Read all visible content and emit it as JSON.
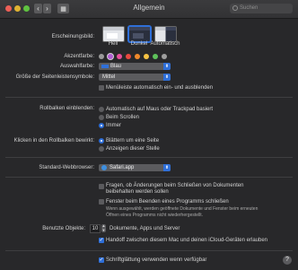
{
  "window": {
    "title": "Allgemein",
    "search_placeholder": "Suchen"
  },
  "appearance": {
    "label": "Erscheinungsbild:",
    "options": [
      {
        "name": "Hell",
        "selected": false
      },
      {
        "name": "Dunkel",
        "selected": true
      },
      {
        "name": "Automatisch",
        "selected": false
      }
    ]
  },
  "accent": {
    "label": "Akzentfarbe:",
    "colors": [
      "#9a9a9a",
      "#b15bd1",
      "#e84f9b",
      "#e8493e",
      "#f08a2b",
      "#f6c343",
      "#5ec25a",
      "#9e9e9e"
    ]
  },
  "highlight": {
    "label": "Auswahlfarbe:",
    "value": "Blau",
    "swatch_color": "#2f6fd8"
  },
  "sidebar_icon_size": {
    "label": "Größe der Seitenleistensymbole:",
    "value": "Mittel"
  },
  "menubar_autohide": {
    "label": "Menüleiste automatisch ein- und ausblenden",
    "checked": false
  },
  "scrollbars_show": {
    "label": "Rollbalken einblenden:",
    "options": [
      {
        "label": "Automatisch auf Maus oder Trackpad basiert",
        "selected": false
      },
      {
        "label": "Beim Scrollen",
        "selected": false
      },
      {
        "label": "Immer",
        "selected": true
      }
    ]
  },
  "scroll_click": {
    "label": "Klicken in den Rollbalken bewirkt:",
    "options": [
      {
        "label": "Blättern um eine Seite",
        "selected": true
      },
      {
        "label": "Anzeigen dieser Stelle",
        "selected": false
      }
    ]
  },
  "browser": {
    "label": "Standard-Webbrowser:",
    "value": "Safari.app"
  },
  "ask_keep_changes": {
    "label": "Fragen, ob Änderungen beim Schließen von Dokumenten beibehalten werden sollen",
    "checked": false
  },
  "close_windows": {
    "label": "Fenster beim Beenden eines Programms schließen",
    "checked": false
  },
  "close_windows_note": "Wenn ausgewählt, werden geöffnete Dokumente und Fenster beim erneuten Öffnen eines Programms nicht wiederhergestellt.",
  "recent_items": {
    "label": "Benutzte Objekte:",
    "value": "10",
    "suffix": "Dokumente, Apps und Server"
  },
  "handoff": {
    "label": "Handoff zwischen diesem Mac und deinen iCloud-Geräten erlauben",
    "checked": true
  },
  "font_smoothing": {
    "label": "Schriftglättung verwenden wenn verfügbar",
    "checked": true
  },
  "help_button": "?"
}
